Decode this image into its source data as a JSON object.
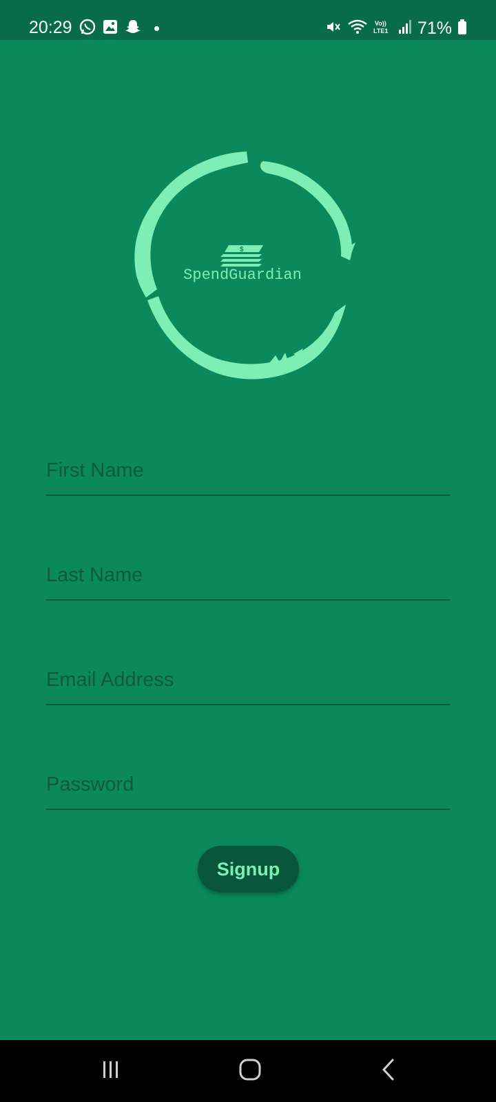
{
  "status_bar": {
    "time": "20:29",
    "battery": "71%",
    "left_icons": [
      "whatsapp-icon",
      "gallery-icon",
      "snapchat-icon",
      "notification-dot-icon"
    ],
    "right_icons": [
      "mute-icon",
      "wifi-icon",
      "volte-icon",
      "signal-icon",
      "battery-icon"
    ],
    "volte_label": "Vo)) LTE1"
  },
  "logo": {
    "brand_name": "SpendGuardian",
    "icon": "money-stack-icon",
    "color": "#7eefb4"
  },
  "form": {
    "first_name": {
      "placeholder": "First Name",
      "value": ""
    },
    "last_name": {
      "placeholder": "Last Name",
      "value": ""
    },
    "email": {
      "placeholder": "Email Address",
      "value": ""
    },
    "password": {
      "placeholder": "Password",
      "value": ""
    },
    "signup_label": "Signup"
  },
  "nav_bar": {
    "buttons": [
      "recents-icon",
      "home-icon",
      "back-icon"
    ]
  },
  "colors": {
    "background": "#0b885c",
    "status_bar": "#086b4a",
    "accent": "#7eefb4",
    "button": "#07553b"
  }
}
